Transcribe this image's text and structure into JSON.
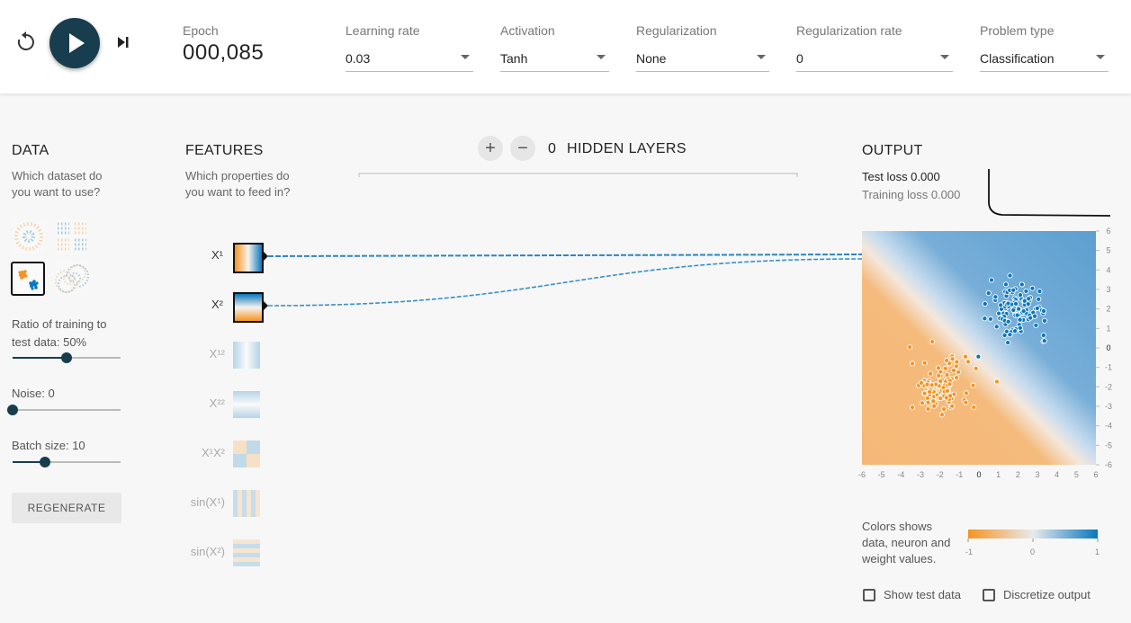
{
  "controls": {
    "epoch_label": "Epoch",
    "epoch_value": "000,085",
    "learning_rate_label": "Learning rate",
    "learning_rate_value": "0.03",
    "activation_label": "Activation",
    "activation_value": "Tanh",
    "regularization_label": "Regularization",
    "regularization_value": "None",
    "reg_rate_label": "Regularization rate",
    "reg_rate_value": "0",
    "problem_type_label": "Problem type",
    "problem_type_value": "Classification"
  },
  "data_panel": {
    "title": "DATA",
    "subtitle_line1": "Which dataset do",
    "subtitle_line2": "you want to use?",
    "ratio_label_line1": "Ratio of training to",
    "ratio_label_line2": "test data:  50%",
    "ratio_value": 0.5,
    "noise_label": "Noise:  0",
    "noise_value": 0,
    "batch_label": "Batch size:  10",
    "batch_value": 0.3,
    "regenerate_label": "REGENERATE"
  },
  "features_panel": {
    "title": "FEATURES",
    "subtitle_line1": "Which properties do",
    "subtitle_line2": "you want to feed in?",
    "items": [
      {
        "label": "X¹",
        "active": true
      },
      {
        "label": "X²",
        "active": true
      },
      {
        "label": "X¹²",
        "active": false
      },
      {
        "label": "X²²",
        "active": false
      },
      {
        "label": "X¹X²",
        "active": false
      },
      {
        "label": "sin(X¹)",
        "active": false
      },
      {
        "label": "sin(X²)",
        "active": false
      }
    ]
  },
  "network": {
    "add_symbol": "+",
    "remove_symbol": "−",
    "hidden_layers_count": "0",
    "hidden_layers_label": "HIDDEN LAYERS"
  },
  "output_panel": {
    "title": "OUTPUT",
    "test_loss": "Test loss 0.000",
    "training_loss": "Training loss 0.000",
    "axis_ticks": [
      "-6",
      "-5",
      "-4",
      "-3",
      "-2",
      "-1",
      "0",
      "1",
      "2",
      "3",
      "4",
      "5",
      "6"
    ],
    "legend_line1": "Colors shows",
    "legend_line2": "data, neuron and",
    "legend_line3": "weight values.",
    "legend_min": "-1",
    "legend_mid": "0",
    "legend_max": "1",
    "show_test_label": "Show test data",
    "discretize_label": "Discretize output"
  },
  "colors": {
    "orange": "#f59322",
    "blue": "#0877bd",
    "dark": "#183d4e"
  }
}
